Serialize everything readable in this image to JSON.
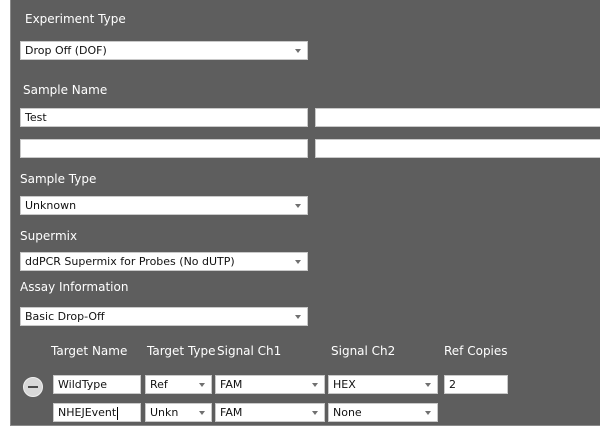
{
  "experiment_type": {
    "label": "Experiment Type",
    "value": "Drop Off (DOF)"
  },
  "sample_name": {
    "label": "Sample Name",
    "fields": [
      "Test",
      "",
      "",
      ""
    ]
  },
  "sample_type": {
    "label": "Sample Type",
    "value": "Unknown"
  },
  "supermix": {
    "label": "Supermix",
    "value": "ddPCR Supermix for Probes (No dUTP)"
  },
  "assay_information": {
    "label": "Assay Information",
    "value": "Basic Drop-Off"
  },
  "targets": {
    "headers": {
      "target_name": "Target Name",
      "target_type": "Target Type",
      "signal_ch1": "Signal Ch1",
      "signal_ch2": "Signal Ch2",
      "ref_copies": "Ref Copies"
    },
    "rows": [
      {
        "target_name": "WildType",
        "target_type": "Ref",
        "signal_ch1": "FAM",
        "signal_ch2": "HEX",
        "ref_copies": "2"
      },
      {
        "target_name": "NHEJEvent",
        "target_type": "Unkn",
        "signal_ch1": "FAM",
        "signal_ch2": "None",
        "ref_copies": ""
      }
    ]
  },
  "icons": {
    "remove_target": "minus-circle-icon",
    "dropdown": "chevron-down-icon"
  },
  "colors": {
    "panel_bg": "#5e5e5e",
    "field_bg": "#ffffff",
    "label_text": "#ffffff"
  }
}
